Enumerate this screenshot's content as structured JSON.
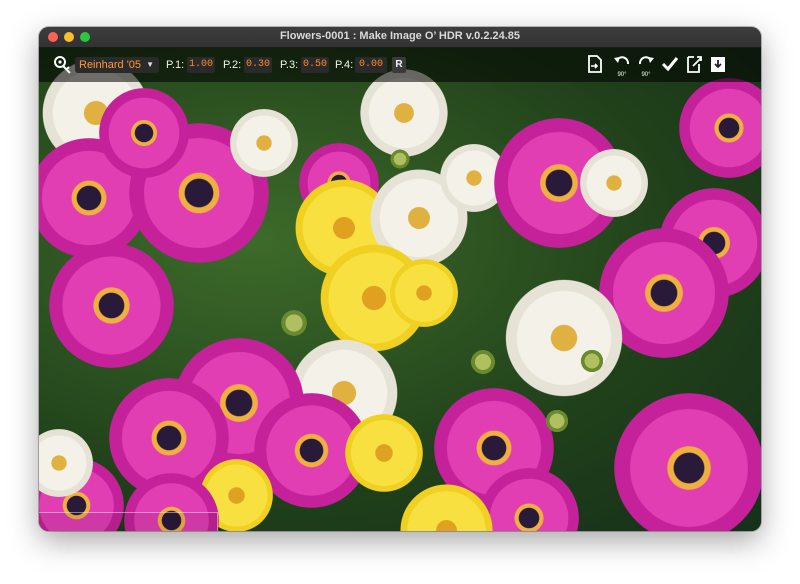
{
  "window": {
    "title": "Flowers-0001 : Make Image O’ HDR v.0.2.24.85"
  },
  "toolbar": {
    "logo_icon": "tonemap-logo-icon",
    "operator": "Reinhard '05",
    "params": [
      {
        "label": "P.1:",
        "value": "1.00"
      },
      {
        "label": "P.2:",
        "value": "0.30"
      },
      {
        "label": "P.3:",
        "value": "0.50"
      },
      {
        "label": "P.4:",
        "value": "0.00"
      }
    ],
    "reset_label": "R",
    "actions": [
      {
        "name": "export-icon",
        "sub": ""
      },
      {
        "name": "rotate-left-icon",
        "sub": "90°"
      },
      {
        "name": "rotate-right-icon",
        "sub": "90°"
      },
      {
        "name": "check-icon",
        "sub": ""
      },
      {
        "name": "copy-settings-icon",
        "sub": ""
      },
      {
        "name": "save-icon",
        "sub": ""
      }
    ]
  },
  "colors": {
    "accent": "#ff8a30",
    "toolbar_bg": "#000000",
    "histogram_frame": "#ffffff"
  },
  "image": {
    "subject": "flowers"
  }
}
